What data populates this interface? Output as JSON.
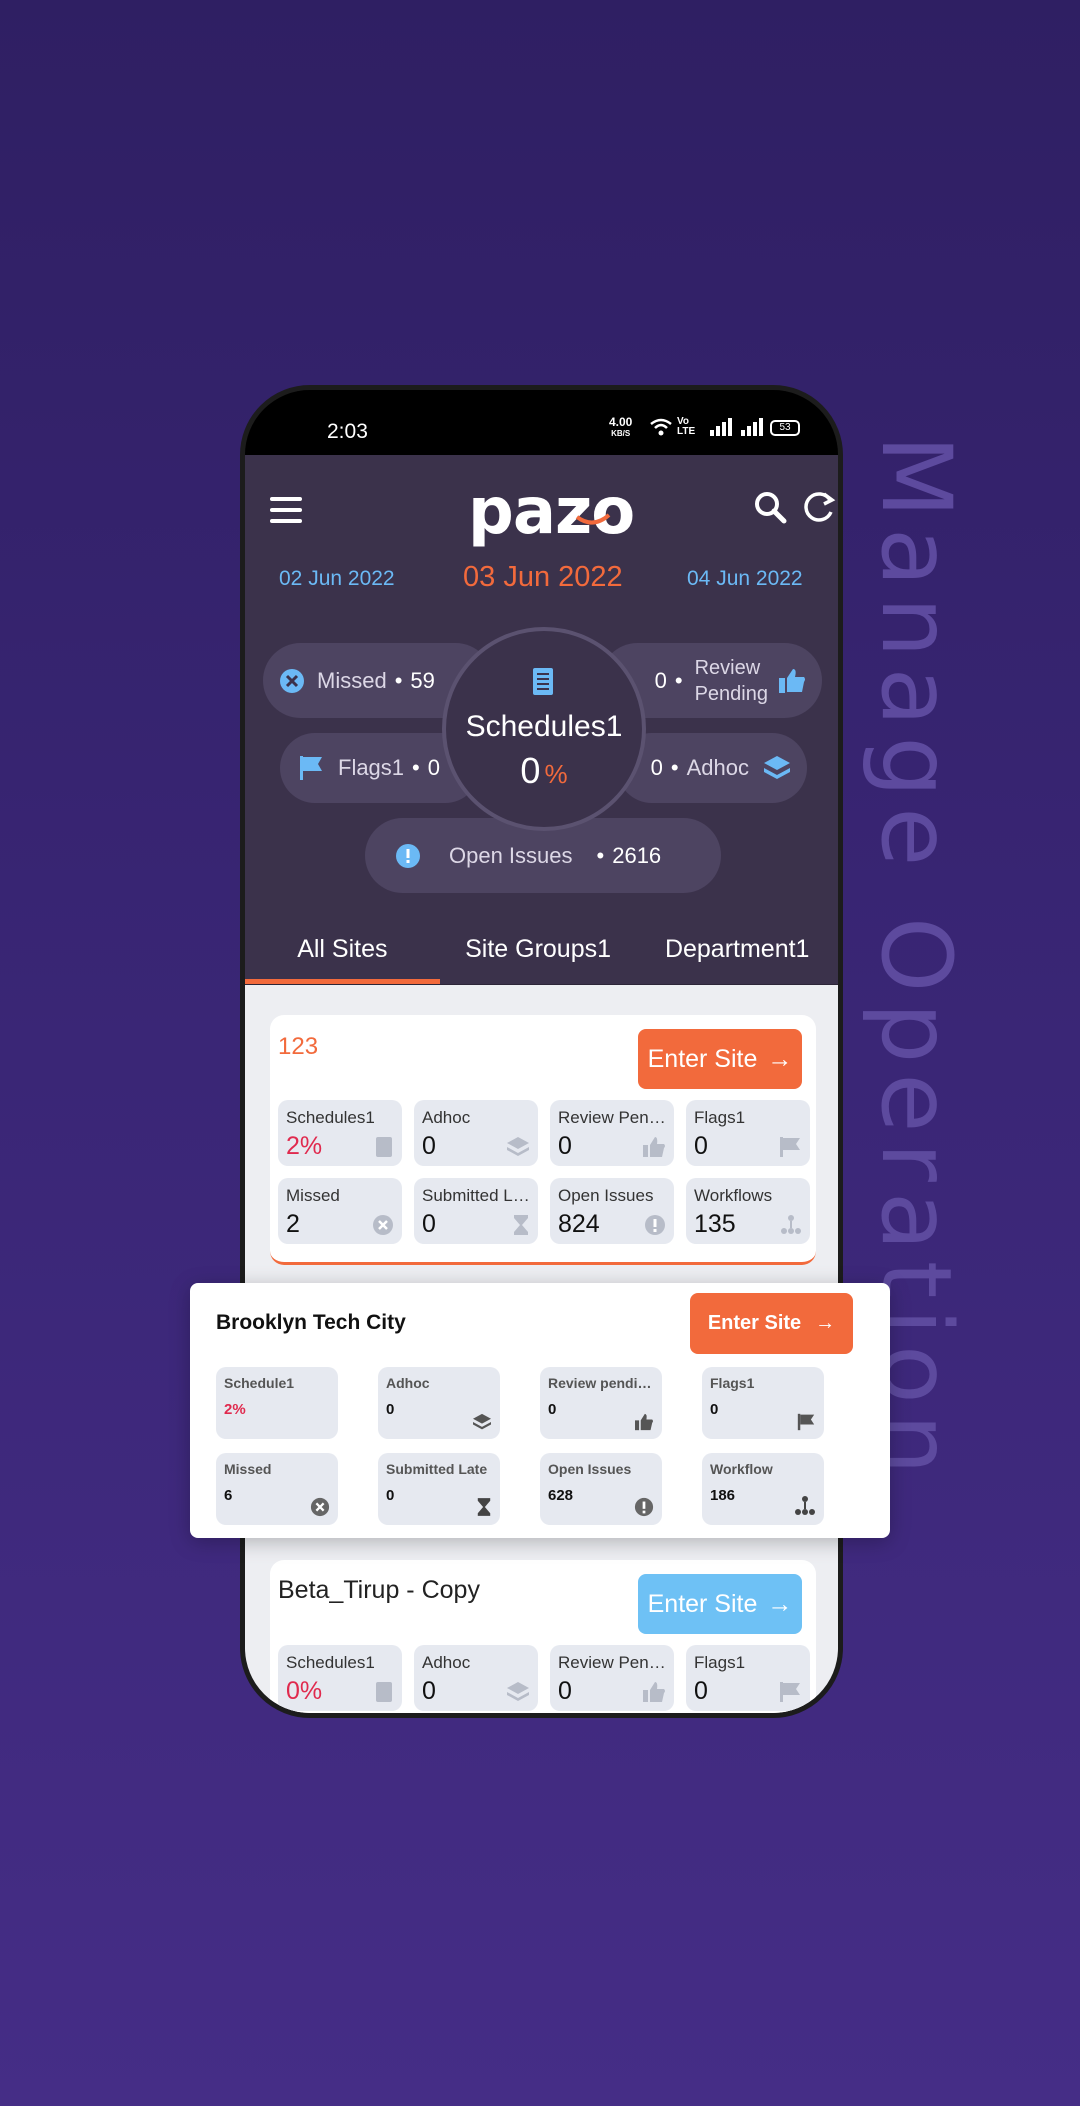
{
  "tagline": "Manage Operation",
  "status_bar": {
    "time": "2:03",
    "net_speed": "4.00",
    "net_unit": "KB/S",
    "volte": "Vo LTE",
    "battery": "53"
  },
  "header": {
    "logo": "pazo",
    "menu_icon": "hamburger-icon",
    "search_icon": "search-icon",
    "refresh_icon": "refresh-icon"
  },
  "dates": {
    "prev": "02 Jun 2022",
    "current": "03 Jun 2022",
    "next": "04 Jun 2022"
  },
  "summary": {
    "missed": {
      "label": "Missed",
      "value": "59"
    },
    "review": {
      "label_line1": "Review",
      "label_line2": "Pending",
      "value": "0"
    },
    "flags": {
      "label": "Flags1",
      "value": "0"
    },
    "adhoc": {
      "label": "Adhoc",
      "value": "0"
    },
    "open_issues": {
      "label": "Open Issues",
      "value": "2616"
    },
    "center": {
      "title": "Schedules1",
      "value": "0",
      "unit": "%"
    },
    "dot": "•"
  },
  "tabs": [
    "All Sites",
    "Site Groups1",
    "Department1"
  ],
  "colors": {
    "accent": "#f26a3c",
    "header_bg": "#3b324b",
    "blue": "#6bb9f5",
    "red": "#e02a4e"
  },
  "sites": [
    {
      "name": "123",
      "button": "Enter Site",
      "stats": [
        {
          "label": "Schedules1",
          "value": "2%"
        },
        {
          "label": "Adhoc",
          "value": "0"
        },
        {
          "label": "Review Pending",
          "value": "0"
        },
        {
          "label": "Flags1",
          "value": "0"
        },
        {
          "label": "Missed",
          "value": "2"
        },
        {
          "label": "Submitted Late",
          "value": "0"
        },
        {
          "label": "Open Issues",
          "value": "824"
        },
        {
          "label": "Workflows",
          "value": "135"
        }
      ]
    },
    {
      "name": "Brooklyn Tech City",
      "button": "Enter Site",
      "stats": [
        {
          "label": "Schedule1",
          "value": "2%"
        },
        {
          "label": "Adhoc",
          "value": "0"
        },
        {
          "label": "Review pending",
          "value": "0"
        },
        {
          "label": "Flags1",
          "value": "0"
        },
        {
          "label": "Missed",
          "value": "6"
        },
        {
          "label": "Submitted Late",
          "value": "0"
        },
        {
          "label": "Open Issues",
          "value": "628"
        },
        {
          "label": "Workflow",
          "value": "186"
        }
      ]
    },
    {
      "name": "Beta_Tirup  - Copy",
      "button": "Enter Site",
      "stats": [
        {
          "label": "Schedules1",
          "value": "0%"
        },
        {
          "label": "Adhoc",
          "value": "0"
        },
        {
          "label": "Review Pending",
          "value": "0"
        },
        {
          "label": "Flags1",
          "value": "0"
        }
      ]
    }
  ]
}
